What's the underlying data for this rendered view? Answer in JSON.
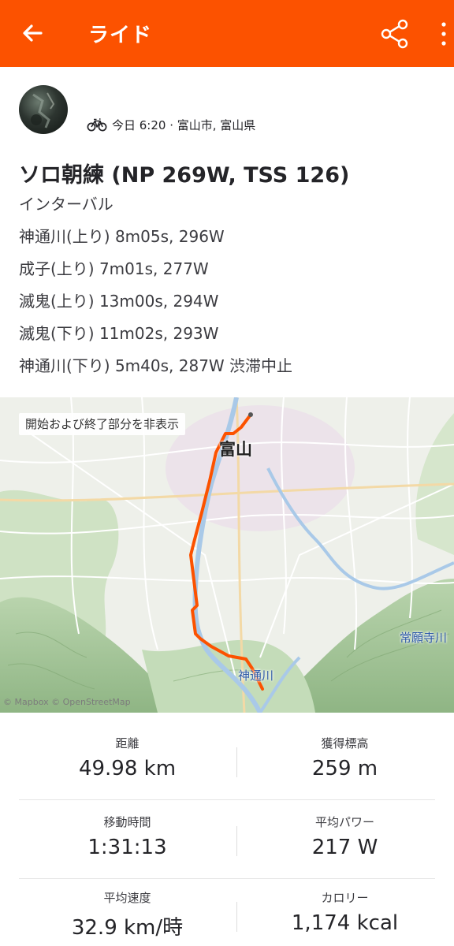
{
  "header": {
    "title": "ライド",
    "back_icon": "arrow-left-icon",
    "share_icon": "share-icon",
    "more_icon": "more-vertical-icon",
    "color": "#fc5200"
  },
  "activity": {
    "meta": "今日 6:20 · 富山市, 富山県",
    "type_icon": "bike-icon",
    "title": "ソロ朝練 (NP 269W, TSS 126)",
    "description": [
      "インターバル",
      "神通川(上り) 8m05s, 296W",
      "成子(上り) 7m01s, 277W",
      "滅鬼(上り) 13m00s, 294W",
      "滅鬼(下り) 11m02s, 293W",
      "神通川(下り) 5m40s, 287W 渋滞中止"
    ]
  },
  "map": {
    "toggle_label": "開始および終了部分を非表示",
    "city_label": "富山",
    "place_joganji": "常願寺川",
    "place_jinzu": "神通川",
    "attribution": "© Mapbox © OpenStreetMap",
    "route_color": "#fc5200"
  },
  "stats": [
    {
      "label": "距離",
      "value": "49.98 km"
    },
    {
      "label": "獲得標高",
      "value": "259 m"
    },
    {
      "label": "移動時間",
      "value": "1:31:13"
    },
    {
      "label": "平均パワー",
      "value": "217 W"
    },
    {
      "label": "平均速度",
      "value": "32.9 km/時"
    },
    {
      "label": "カロリー",
      "value": "1,174 kcal"
    }
  ]
}
